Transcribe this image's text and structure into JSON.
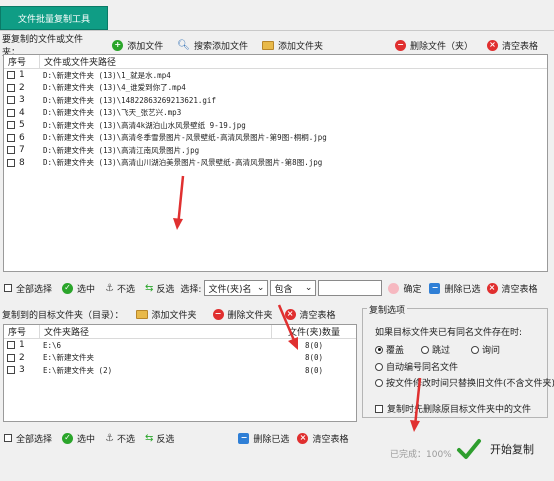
{
  "tab": {
    "label": "文件批量复制工具"
  },
  "source": {
    "label": "要复制的文件或文件夹：",
    "toolbar": {
      "add_file": "添加文件",
      "search_add": "搜索添加文件",
      "add_folder": "添加文件夹",
      "delete": "删除文件（夹）",
      "clear": "清空表格"
    },
    "columns": {
      "no": "序号",
      "path": "文件或文件夹路径"
    },
    "rows": [
      {
        "no": "1",
        "path": "D:\\新建文件夹 (13)\\1_就是水.mp4"
      },
      {
        "no": "2",
        "path": "D:\\新建文件夹 (13)\\4_谁爱到你了.mp4"
      },
      {
        "no": "3",
        "path": "D:\\新建文件夹 (13)\\14822863269213621.gif"
      },
      {
        "no": "4",
        "path": "D:\\新建文件夹 (13)\\飞天_张艺兴.mp3"
      },
      {
        "no": "5",
        "path": "D:\\新建文件夹 (13)\\高清4k湖泊山水风景壁纸 9-19.jpg"
      },
      {
        "no": "6",
        "path": "D:\\新建文件夹 (13)\\高清冬季雪景图片-风景壁纸-高清风景图片-第9图-桐桐.jpg"
      },
      {
        "no": "7",
        "path": "D:\\新建文件夹 (13)\\高清江南风景图片.jpg"
      },
      {
        "no": "8",
        "path": "D:\\新建文件夹 (13)\\高清山川湖泊美景图片-风景壁纸-高清风景图片-第8图.jpg"
      }
    ],
    "filter": {
      "select_all": "全部选择",
      "select": "选中",
      "deselect": "不选",
      "invert": "反选",
      "choose_label": "选择:",
      "field_value": "文件(夹)名",
      "op_value": "包含",
      "keyword": "",
      "confirm": "确定",
      "delete_selected": "删除已选",
      "clear": "清空表格"
    }
  },
  "target": {
    "label": "复制到的目标文件夹（目录）：",
    "toolbar": {
      "add_folder": "添加文件夹",
      "delete": "删除文件夹",
      "clear": "清空表格"
    },
    "columns": {
      "no": "序号",
      "path": "文件夹路径",
      "count": "文件(夹)数量"
    },
    "rows": [
      {
        "no": "1",
        "path": "E:\\6",
        "count": "8(0)"
      },
      {
        "no": "2",
        "path": "E:\\新建文件夹",
        "count": "8(0)"
      },
      {
        "no": "3",
        "path": "E:\\新建文件夹 (2)",
        "count": "8(0)"
      }
    ],
    "bottom": {
      "select_all": "全部选择",
      "select": "选中",
      "deselect": "不选",
      "invert": "反选",
      "delete_selected": "删除已选",
      "clear": "清空表格"
    }
  },
  "options": {
    "title": "复制选项",
    "question": "如果目标文件夹已有同名文件存在时:",
    "overwrite": "覆盖",
    "skip": "跳过",
    "ask": "询问",
    "auto_rename": "自动编号同名文件",
    "by_time": "按文件修改时间只替换旧文件(不含文件夹)",
    "delete_original": "复制时先删除原目标文件夹中的文件"
  },
  "status": {
    "progress_text": "已完成：100%",
    "progress": 100
  },
  "start_button": "开始复制"
}
